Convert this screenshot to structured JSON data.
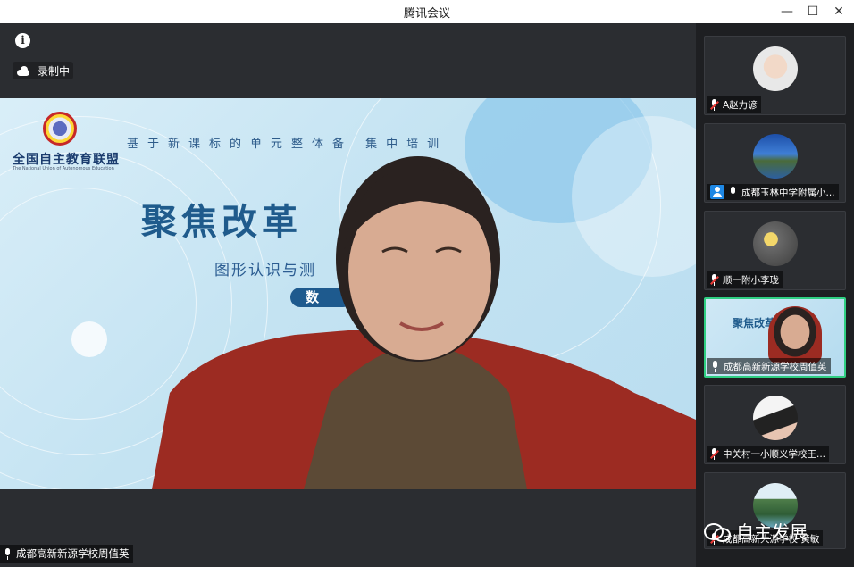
{
  "window": {
    "title": "腾讯会议",
    "minimize_icon": "minimize-icon",
    "maximize_icon": "maximize-icon",
    "close_icon": "close-icon"
  },
  "main": {
    "info_icon": "info-icon",
    "recording": {
      "icon": "cloud-icon",
      "label": "录制中"
    },
    "slide": {
      "logo_text": "全国自主教育联盟",
      "logo_subtext": "The National Union of Autonomous Education",
      "subtitle": "基于新课标的单元整体备 集中培训",
      "title": "聚焦改革",
      "topic": "图形认识与测",
      "pill": "数"
    },
    "speaker_name": "成都高新新源学校周值英"
  },
  "participants": [
    {
      "name": "A赵力谚",
      "muted": true,
      "avatar": "woman-hat-photo",
      "active": false
    },
    {
      "name": "成都玉林中学附属小...",
      "muted": false,
      "badge": "user-icon",
      "avatar": "lake-photo",
      "active": false
    },
    {
      "name": "顺一附小李珑",
      "muted": true,
      "avatar": "flower-photo",
      "active": false
    },
    {
      "name": "成都高新新源学校周值英",
      "muted": false,
      "avatar": "video-thumbnail",
      "active": true
    },
    {
      "name": "中关村一小顺义学校王...",
      "muted": true,
      "avatar": "anime-photo",
      "active": false
    },
    {
      "name": "成都高新大源学校 黄敏",
      "muted": true,
      "avatar": "landscape-photo",
      "active": false
    }
  ],
  "watermark": {
    "icon": "wechat-icon",
    "text": "自主发展"
  },
  "colors": {
    "active_border": "#2fcf82",
    "mute_red": "#e53935",
    "user_badge": "#1e88e5"
  }
}
